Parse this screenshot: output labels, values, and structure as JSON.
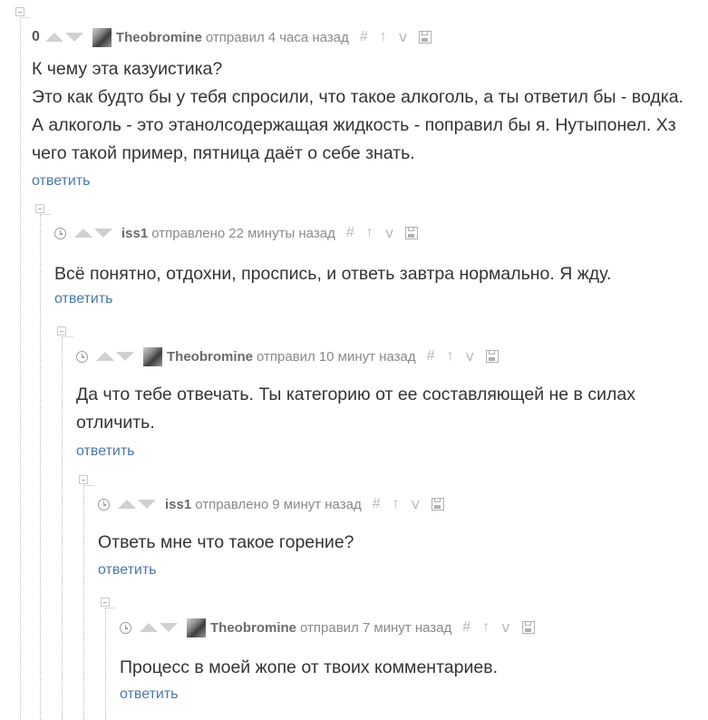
{
  "comments": [
    {
      "rating": "0",
      "author": "Theobromine",
      "verb": "отправил",
      "time": "4 часа назад",
      "lines": [
        "К чему эта казуистика?",
        "Это как будто бы у тебя спросили, что такое алкоголь, а ты ответил бы - водка.",
        "А алкоголь - это этанолсодержащая жидкость - поправил бы я. Нутыпонел. Хз",
        "чего такой пример, пятница даёт о себе знать."
      ],
      "reply_label": "ответить"
    },
    {
      "author": "iss1",
      "verb": "отправлено",
      "time": "22 минуты назад",
      "lines": [
        "Всё понятно, отдохни, проспись, и ответь завтра нормально. Я жду."
      ],
      "reply_label": "ответить"
    },
    {
      "author": "Theobromine",
      "verb": "отправил",
      "time": "10 минут назад",
      "lines": [
        "Да что тебе отвечать. Ты категорию от ее составляющей не в силах",
        "отличить."
      ],
      "reply_label": "ответить"
    },
    {
      "author": "iss1",
      "verb": "отправлено",
      "time": "9 минут назад",
      "lines": [
        "Ответь мне что такое горение?"
      ],
      "reply_label": "ответить"
    },
    {
      "author": "Theobromine",
      "verb": "отправил",
      "time": "7 минут назад",
      "lines": [
        "Процесс в моей жопе от твоих комментариев."
      ],
      "reply_label": "ответить"
    }
  ],
  "icons": {
    "link": "#",
    "parent": "↑",
    "branch": "ⅴ",
    "save": "save-icon"
  },
  "colors": {
    "link": "#4a78a8",
    "text": "#333333",
    "meta": "#8a8a8a"
  }
}
